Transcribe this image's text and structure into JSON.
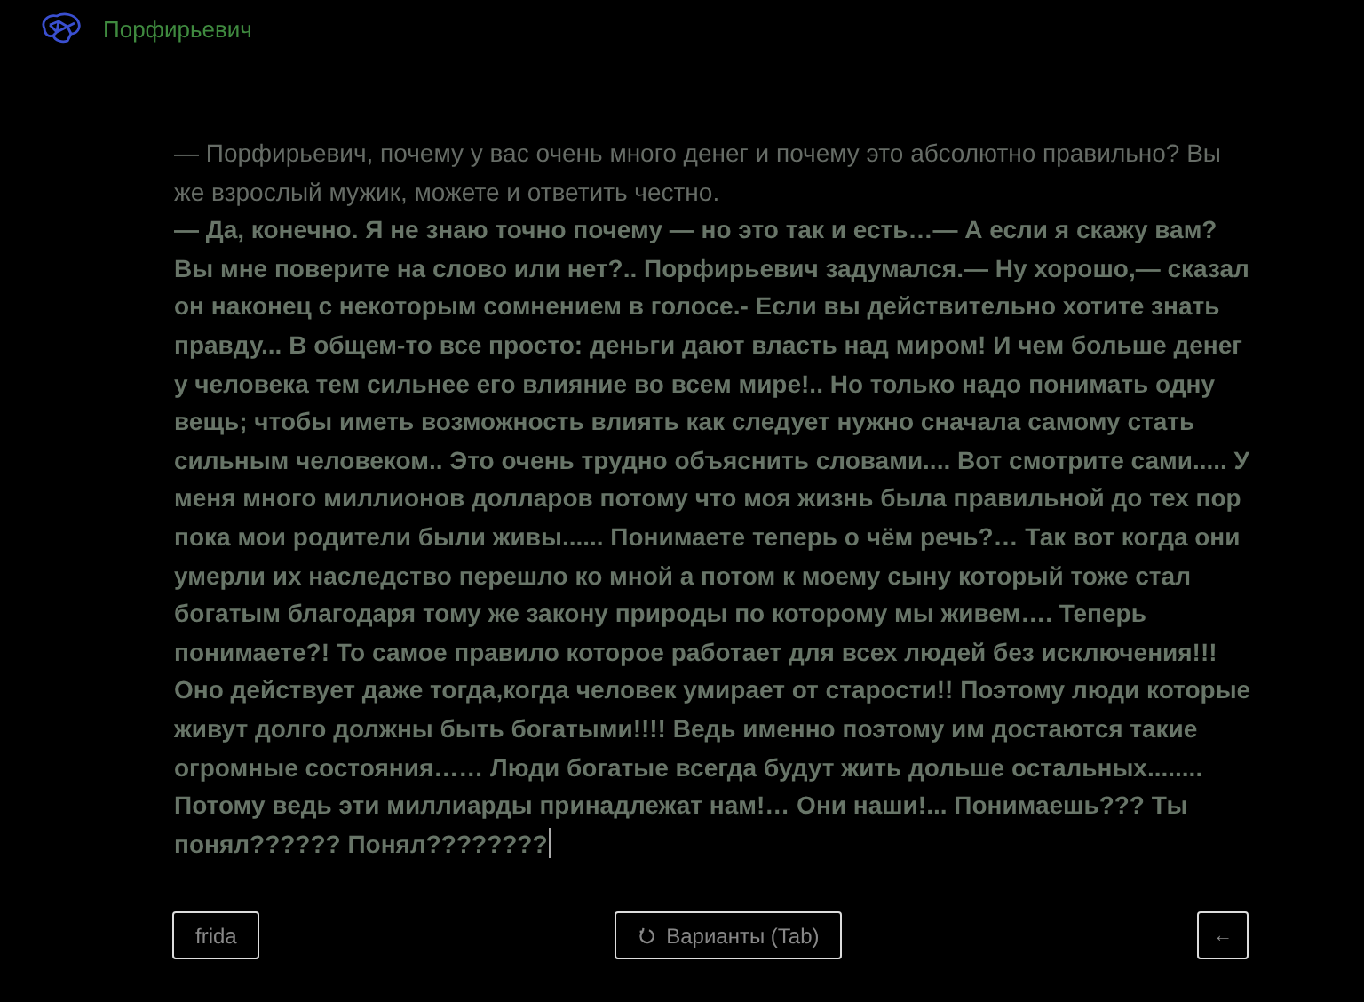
{
  "header": {
    "title": "Порфирьевич"
  },
  "editor": {
    "prompt": "— Порфирьевич, почему у вас очень много денег и почему это абсолютно правильно? Вы же взрослый мужик, можете и ответить честно.",
    "generated": "— Да, конечно. Я не знаю точно почему — но это так и есть…— А если я скажу вам? Вы мне поверите на слово или нет?.. Порфирьевич задумался.— Ну хорошо,— сказал он наконец с некоторым сомнением в голосе.- Если вы действительно хотите знать правду... В общем-то все просто: деньги дают власть над миром! И чем больше денег у человека тем сильнее его влияние во всем мире!.. Но только надо понимать одну вещь; чтобы иметь возможность влиять как следует нужно сначала самому стать сильным человеком.. Это очень трудно объяснить словами.... Вот смотрите сами..... У меня много миллионов долларов потому что моя жизнь была правильной до тех пор пока мои родители были живы...... Понимаете теперь о чём речь?… Так вот когда они умерли их наследство перешло ко мной а потом к моему сыну который тоже стал богатым благодаря тому же закону природы по которому мы живем…. Теперь понимаете?! То самое правило которое работает для всех людей без исключения!!! Оно действует даже тогда,когда человек умирает от старости!! Поэтому люди которые живут долго должны быть богатыми!!!! Ведь именно поэтому им достаются такие огромные состояния…… Люди богатые всегда будут жить дольше остальных........ Потому ведь эти миллиарды принадлежат нам!… Они наши!... Понимаешь??? Ты понял?????? Понял????????",
    "cursor": true
  },
  "toolbar": {
    "model_button": "frida",
    "variants_button": "Варианты (Tab)",
    "back_button": "←"
  }
}
